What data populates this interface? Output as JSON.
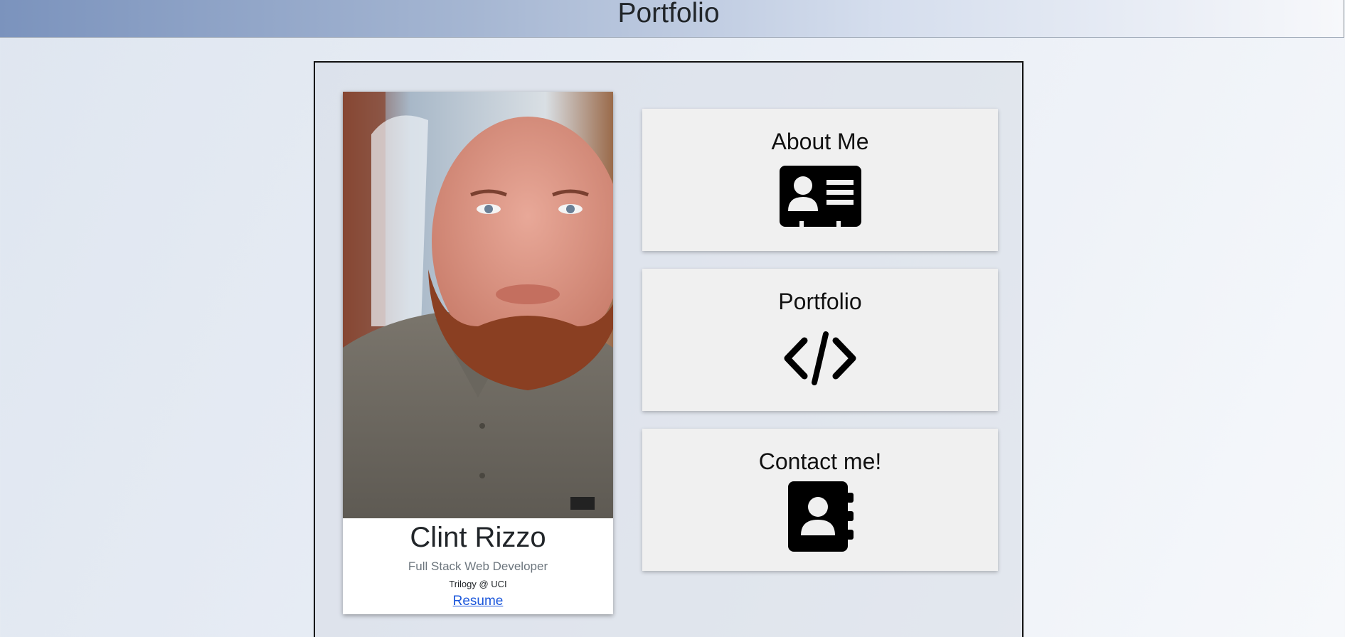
{
  "header": {
    "title": "Portfolio"
  },
  "profile": {
    "name": "Clint Rizzo",
    "role": "Full Stack Web Developer",
    "school": "Trilogy @ UCI",
    "resume_label": "Resume"
  },
  "nav_cards": [
    {
      "label": "About Me",
      "icon": "id-card-icon"
    },
    {
      "label": "Portfolio",
      "icon": "code-icon"
    },
    {
      "label": "Contact me!",
      "icon": "address-book-icon"
    }
  ],
  "colors": {
    "header_gradient_start": "#7b93bd",
    "card_background": "#f0f0f0",
    "link": "#1a56db",
    "subtitle": "#6c757d"
  }
}
